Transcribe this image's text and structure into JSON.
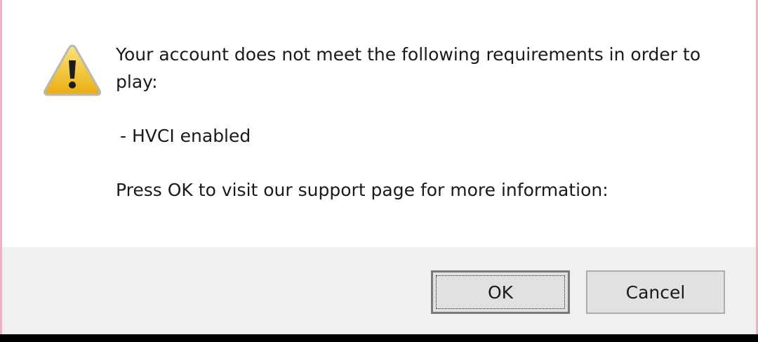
{
  "dialog": {
    "message_line1": "Your account does not meet the following requirements in order to",
    "message_line2": "play:",
    "requirement": " - HVCI enabled",
    "info": "Press OK to visit our support page for more information:",
    "icon": "warning-icon"
  },
  "buttons": {
    "ok_label": "OK",
    "cancel_label": "Cancel"
  },
  "colors": {
    "warning_fill": "#f2c21b",
    "warning_outline": "#b88a00",
    "footer_bg": "#f0f0f0"
  }
}
